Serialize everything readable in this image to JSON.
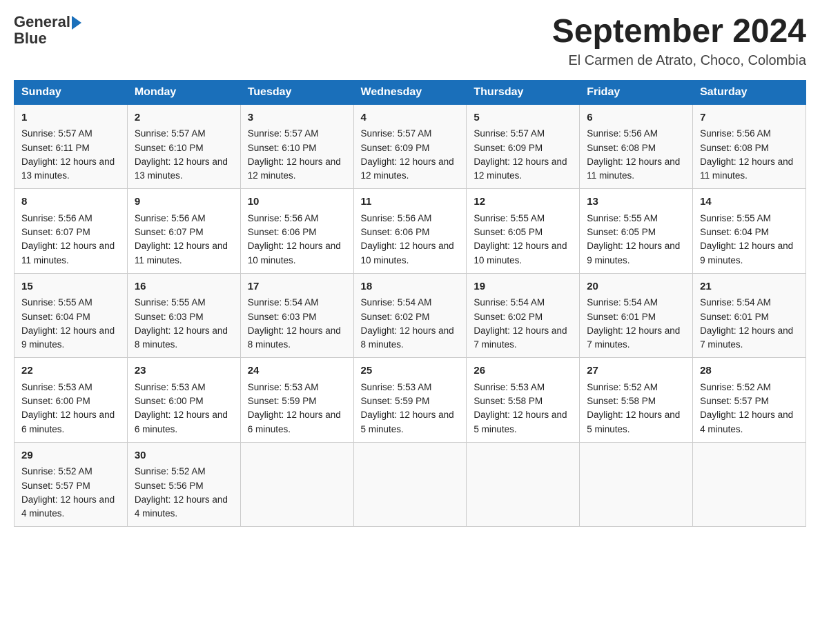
{
  "logo": {
    "general": "General",
    "arrow": "▶",
    "blue": "Blue"
  },
  "title": "September 2024",
  "location": "El Carmen de Atrato, Choco, Colombia",
  "days_header": [
    "Sunday",
    "Monday",
    "Tuesday",
    "Wednesday",
    "Thursday",
    "Friday",
    "Saturday"
  ],
  "weeks": [
    [
      {
        "day": "1",
        "sunrise": "5:57 AM",
        "sunset": "6:11 PM",
        "daylight": "12 hours and 13 minutes."
      },
      {
        "day": "2",
        "sunrise": "5:57 AM",
        "sunset": "6:10 PM",
        "daylight": "12 hours and 13 minutes."
      },
      {
        "day": "3",
        "sunrise": "5:57 AM",
        "sunset": "6:10 PM",
        "daylight": "12 hours and 12 minutes."
      },
      {
        "day": "4",
        "sunrise": "5:57 AM",
        "sunset": "6:09 PM",
        "daylight": "12 hours and 12 minutes."
      },
      {
        "day": "5",
        "sunrise": "5:57 AM",
        "sunset": "6:09 PM",
        "daylight": "12 hours and 12 minutes."
      },
      {
        "day": "6",
        "sunrise": "5:56 AM",
        "sunset": "6:08 PM",
        "daylight": "12 hours and 11 minutes."
      },
      {
        "day": "7",
        "sunrise": "5:56 AM",
        "sunset": "6:08 PM",
        "daylight": "12 hours and 11 minutes."
      }
    ],
    [
      {
        "day": "8",
        "sunrise": "5:56 AM",
        "sunset": "6:07 PM",
        "daylight": "12 hours and 11 minutes."
      },
      {
        "day": "9",
        "sunrise": "5:56 AM",
        "sunset": "6:07 PM",
        "daylight": "12 hours and 11 minutes."
      },
      {
        "day": "10",
        "sunrise": "5:56 AM",
        "sunset": "6:06 PM",
        "daylight": "12 hours and 10 minutes."
      },
      {
        "day": "11",
        "sunrise": "5:56 AM",
        "sunset": "6:06 PM",
        "daylight": "12 hours and 10 minutes."
      },
      {
        "day": "12",
        "sunrise": "5:55 AM",
        "sunset": "6:05 PM",
        "daylight": "12 hours and 10 minutes."
      },
      {
        "day": "13",
        "sunrise": "5:55 AM",
        "sunset": "6:05 PM",
        "daylight": "12 hours and 9 minutes."
      },
      {
        "day": "14",
        "sunrise": "5:55 AM",
        "sunset": "6:04 PM",
        "daylight": "12 hours and 9 minutes."
      }
    ],
    [
      {
        "day": "15",
        "sunrise": "5:55 AM",
        "sunset": "6:04 PM",
        "daylight": "12 hours and 9 minutes."
      },
      {
        "day": "16",
        "sunrise": "5:55 AM",
        "sunset": "6:03 PM",
        "daylight": "12 hours and 8 minutes."
      },
      {
        "day": "17",
        "sunrise": "5:54 AM",
        "sunset": "6:03 PM",
        "daylight": "12 hours and 8 minutes."
      },
      {
        "day": "18",
        "sunrise": "5:54 AM",
        "sunset": "6:02 PM",
        "daylight": "12 hours and 8 minutes."
      },
      {
        "day": "19",
        "sunrise": "5:54 AM",
        "sunset": "6:02 PM",
        "daylight": "12 hours and 7 minutes."
      },
      {
        "day": "20",
        "sunrise": "5:54 AM",
        "sunset": "6:01 PM",
        "daylight": "12 hours and 7 minutes."
      },
      {
        "day": "21",
        "sunrise": "5:54 AM",
        "sunset": "6:01 PM",
        "daylight": "12 hours and 7 minutes."
      }
    ],
    [
      {
        "day": "22",
        "sunrise": "5:53 AM",
        "sunset": "6:00 PM",
        "daylight": "12 hours and 6 minutes."
      },
      {
        "day": "23",
        "sunrise": "5:53 AM",
        "sunset": "6:00 PM",
        "daylight": "12 hours and 6 minutes."
      },
      {
        "day": "24",
        "sunrise": "5:53 AM",
        "sunset": "5:59 PM",
        "daylight": "12 hours and 6 minutes."
      },
      {
        "day": "25",
        "sunrise": "5:53 AM",
        "sunset": "5:59 PM",
        "daylight": "12 hours and 5 minutes."
      },
      {
        "day": "26",
        "sunrise": "5:53 AM",
        "sunset": "5:58 PM",
        "daylight": "12 hours and 5 minutes."
      },
      {
        "day": "27",
        "sunrise": "5:52 AM",
        "sunset": "5:58 PM",
        "daylight": "12 hours and 5 minutes."
      },
      {
        "day": "28",
        "sunrise": "5:52 AM",
        "sunset": "5:57 PM",
        "daylight": "12 hours and 4 minutes."
      }
    ],
    [
      {
        "day": "29",
        "sunrise": "5:52 AM",
        "sunset": "5:57 PM",
        "daylight": "12 hours and 4 minutes."
      },
      {
        "day": "30",
        "sunrise": "5:52 AM",
        "sunset": "5:56 PM",
        "daylight": "12 hours and 4 minutes."
      },
      null,
      null,
      null,
      null,
      null
    ]
  ]
}
